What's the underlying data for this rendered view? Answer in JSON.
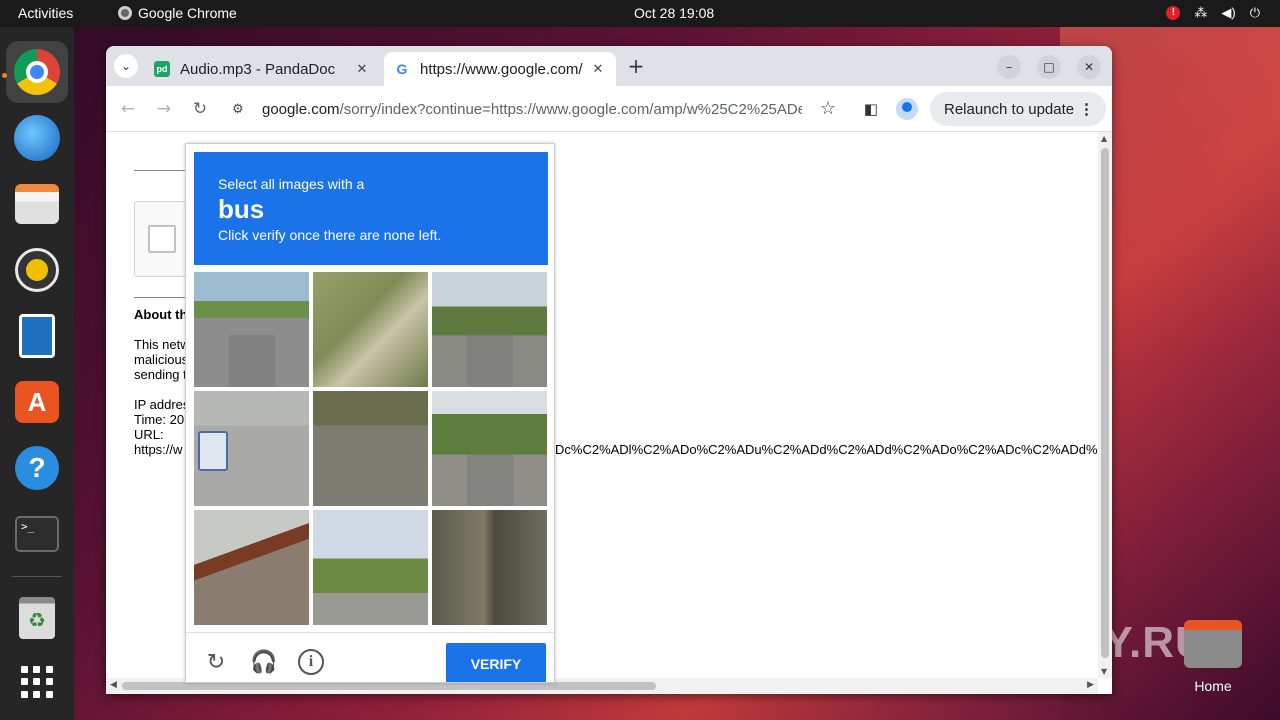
{
  "topbar": {
    "activities": "Activities",
    "app_name": "Google Chrome",
    "clock": "Oct 28  19:08",
    "alert": "!"
  },
  "dock": {
    "items": [
      "chrome-icon",
      "thunderbird-icon",
      "files-icon",
      "rhythmbox-icon",
      "writer-icon",
      "app-center-icon",
      "help-icon",
      "terminal-icon",
      "trash-icon",
      "app-grid-icon"
    ],
    "terminal_prompt": ">_"
  },
  "desktop": {
    "home_label": "Home",
    "watermark": "ANY.RUN"
  },
  "browser": {
    "tabs": [
      {
        "title": "Audio.mp3 - PandaDoc",
        "active": false
      },
      {
        "title": "https://www.google.com/",
        "active": true
      }
    ],
    "url_host": "google.com",
    "url_path": "/sorry/index?continue=https://www.google.com/amp/w%25C2%25ADe...",
    "relaunch_label": "Relaunch to update",
    "window_controls": [
      "minimize",
      "maximize",
      "close"
    ]
  },
  "page": {
    "about_heading": "About th",
    "para1": "This netw\nmalicious\nsending t",
    "para2": "IP addres\nTime: 20\nURL:\nhttps://w",
    "url_tail": "Dc%C2%ADl%C2%ADo%C2%ADu%C2%ADd%C2%ADd%C2%ADo%C2%ADc%C2%ADd%"
  },
  "captcha": {
    "instruction_line1": "Select all images with a",
    "target_word": "bus",
    "instruction_line3": "Click verify once there are none left.",
    "verify_label": "VERIFY",
    "tiles": [
      "tile-1",
      "tile-2",
      "tile-3",
      "tile-4",
      "tile-5",
      "tile-6",
      "tile-7",
      "tile-8",
      "tile-9"
    ],
    "accent_color": "#1a73e8"
  }
}
